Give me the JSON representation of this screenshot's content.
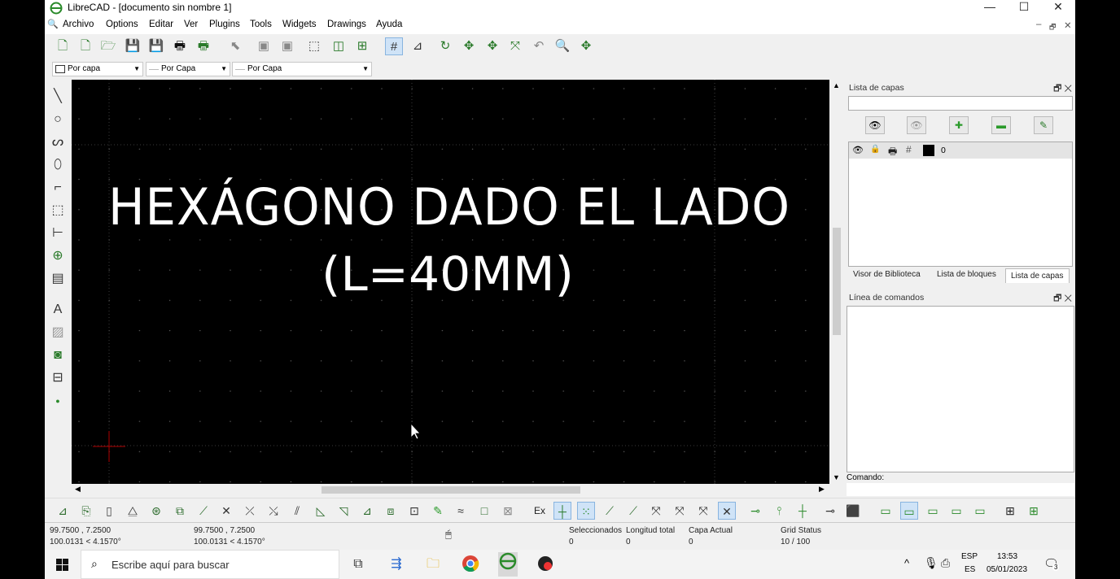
{
  "window": {
    "title": "LibreCAD - [documento sin nombre 1]",
    "minimize": "—",
    "maximize": "☐",
    "close": "✕"
  },
  "menu": [
    "Archivo",
    "Options",
    "Editar",
    "Ver",
    "Plugins",
    "Tools",
    "Widgets",
    "Drawings",
    "Ayuda"
  ],
  "menu_right": {
    "min": "–",
    "restore": "🗗",
    "close": "✕"
  },
  "pen_toolbar": {
    "color": "Por capa",
    "width": "Por Capa",
    "type": "Por Capa"
  },
  "canvas": {
    "line1": "HEXÁGONO DADO EL LADO",
    "line2": "(L=40MM)"
  },
  "layer_panel": {
    "title": "Lista de capas",
    "filter_value": "",
    "layers": [
      {
        "name": "0"
      }
    ],
    "tabs": [
      "Visor de Biblioteca",
      "Lista de bloques",
      "Lista de capas"
    ]
  },
  "command_panel": {
    "title": "Línea de comandos",
    "prompt": "Comando:"
  },
  "bottom_toolbar": {
    "ex_label": "Ex"
  },
  "status": {
    "coord_abs_1": "99.7500 , 7.2500",
    "coord_abs_2": "100.0131 < 4.1570°",
    "coord_rel_1": "99.7500 , 7.2500",
    "coord_rel_2": "100.0131 < 4.1570°",
    "selected_label": "Seleccionados",
    "selected_value": "0",
    "length_label": "Longitud total",
    "length_value": "0",
    "layer_label": "Capa Actual",
    "layer_value": "0",
    "grid_label": "Grid Status",
    "grid_value": "10 / 100"
  },
  "taskbar": {
    "search_placeholder": "Escribe aquí para buscar",
    "lang_1": "ESP",
    "lang_2": "ES",
    "time": "13:53",
    "date": "05/01/2023",
    "notifications": "3"
  },
  "colors": {
    "canvas": "#000000",
    "grid_dot": "#5a5a5a",
    "crosshair": "#b00000",
    "text": "#ffffff"
  }
}
